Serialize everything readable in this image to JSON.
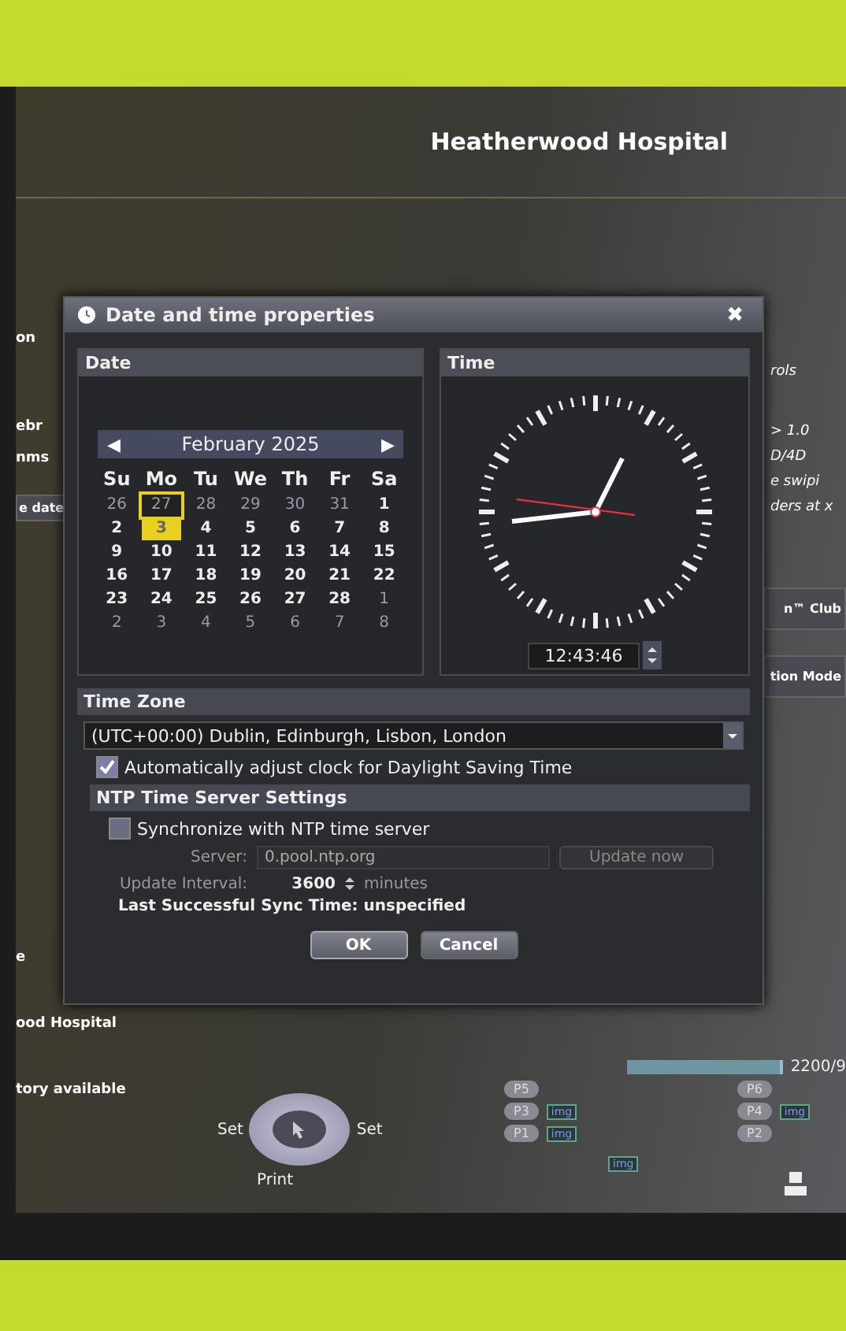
{
  "header": {
    "title": "Heatherwood Hospital"
  },
  "background_left": [
    {
      "text": "on",
      "kind": "label"
    },
    {
      "text": "ebr",
      "kind": "label"
    },
    {
      "text": "nms",
      "kind": "label"
    },
    {
      "text": "e date",
      "kind": "button"
    },
    {
      "text": "e",
      "kind": "label"
    },
    {
      "text": "ood Hospital",
      "kind": "label"
    },
    {
      "text": "tory available",
      "kind": "label"
    }
  ],
  "background_right": [
    {
      "text": "rols",
      "kind": "label"
    },
    {
      "text": "> 1.0",
      "kind": "label"
    },
    {
      "text": "D/4D",
      "kind": "label"
    },
    {
      "text": "e swipi",
      "kind": "label"
    },
    {
      "text": "ders at x",
      "kind": "label"
    },
    {
      "text": "n™ Club",
      "kind": "button"
    },
    {
      "text": "tion Mode",
      "kind": "button"
    }
  ],
  "dialog": {
    "title": "Date and time properties",
    "close": "✖",
    "date": {
      "heading": "Date",
      "prev": "◀",
      "next": "▶",
      "month": "February 2025",
      "weekdays": [
        "Su",
        "Mo",
        "Tu",
        "We",
        "Th",
        "Fr",
        "Sa"
      ],
      "days": [
        {
          "text": "26",
          "other_month": true,
          "selected": false,
          "hovered": false
        },
        {
          "text": "27",
          "other_month": true,
          "selected": false,
          "hovered": true
        },
        {
          "text": "28",
          "other_month": true,
          "selected": false,
          "hovered": false
        },
        {
          "text": "29",
          "other_month": true,
          "selected": false,
          "hovered": false
        },
        {
          "text": "30",
          "other_month": true,
          "selected": false,
          "hovered": false
        },
        {
          "text": "31",
          "other_month": true,
          "selected": false,
          "hovered": false
        },
        {
          "text": "1",
          "other_month": false,
          "selected": false,
          "hovered": false
        },
        {
          "text": "2",
          "other_month": false,
          "selected": false,
          "hovered": false
        },
        {
          "text": "3",
          "other_month": false,
          "selected": true,
          "hovered": false
        },
        {
          "text": "4",
          "other_month": false,
          "selected": false,
          "hovered": false
        },
        {
          "text": "5",
          "other_month": false,
          "selected": false,
          "hovered": false
        },
        {
          "text": "6",
          "other_month": false,
          "selected": false,
          "hovered": false
        },
        {
          "text": "7",
          "other_month": false,
          "selected": false,
          "hovered": false
        },
        {
          "text": "8",
          "other_month": false,
          "selected": false,
          "hovered": false
        },
        {
          "text": "9",
          "other_month": false,
          "selected": false,
          "hovered": false
        },
        {
          "text": "10",
          "other_month": false,
          "selected": false,
          "hovered": false
        },
        {
          "text": "11",
          "other_month": false,
          "selected": false,
          "hovered": false
        },
        {
          "text": "12",
          "other_month": false,
          "selected": false,
          "hovered": false
        },
        {
          "text": "13",
          "other_month": false,
          "selected": false,
          "hovered": false
        },
        {
          "text": "14",
          "other_month": false,
          "selected": false,
          "hovered": false
        },
        {
          "text": "15",
          "other_month": false,
          "selected": false,
          "hovered": false
        },
        {
          "text": "16",
          "other_month": false,
          "selected": false,
          "hovered": false
        },
        {
          "text": "17",
          "other_month": false,
          "selected": false,
          "hovered": false
        },
        {
          "text": "18",
          "other_month": false,
          "selected": false,
          "hovered": false
        },
        {
          "text": "19",
          "other_month": false,
          "selected": false,
          "hovered": false
        },
        {
          "text": "20",
          "other_month": false,
          "selected": false,
          "hovered": false
        },
        {
          "text": "21",
          "other_month": false,
          "selected": false,
          "hovered": false
        },
        {
          "text": "22",
          "other_month": false,
          "selected": false,
          "hovered": false
        },
        {
          "text": "23",
          "other_month": false,
          "selected": false,
          "hovered": false
        },
        {
          "text": "24",
          "other_month": false,
          "selected": false,
          "hovered": false
        },
        {
          "text": "25",
          "other_month": false,
          "selected": false,
          "hovered": false
        },
        {
          "text": "26",
          "other_month": false,
          "selected": false,
          "hovered": false
        },
        {
          "text": "27",
          "other_month": false,
          "selected": false,
          "hovered": false
        },
        {
          "text": "28",
          "other_month": false,
          "selected": false,
          "hovered": false
        },
        {
          "text": "1",
          "other_month": true,
          "selected": false,
          "hovered": false
        },
        {
          "text": "2",
          "other_month": true,
          "selected": false,
          "hovered": false
        },
        {
          "text": "3",
          "other_month": true,
          "selected": false,
          "hovered": false
        },
        {
          "text": "4",
          "other_month": true,
          "selected": false,
          "hovered": false
        },
        {
          "text": "5",
          "other_month": true,
          "selected": false,
          "hovered": false
        },
        {
          "text": "6",
          "other_month": true,
          "selected": false,
          "hovered": false
        },
        {
          "text": "7",
          "other_month": true,
          "selected": false,
          "hovered": false
        },
        {
          "text": "8",
          "other_month": true,
          "selected": false,
          "hovered": false
        }
      ]
    },
    "time": {
      "heading": "Time",
      "value": "12:43:46"
    },
    "time_zone": {
      "heading": "Time Zone",
      "value": "(UTC+00:00) Dublin, Edinburgh, Lisbon, London",
      "dst_label": "Automatically adjust clock for Daylight Saving Time",
      "dst_checked": true
    },
    "ntp": {
      "heading": "NTP Time Server Settings",
      "sync_label": "Synchronize with NTP time server",
      "sync_checked": false,
      "server_label": "Server:",
      "server": "0.pool.ntp.org",
      "update_button": "Update now",
      "interval_label": "Update Interval:",
      "interval": "3600",
      "interval_unit": "minutes",
      "last_sync": "Last Successful Sync Time: unspecified"
    },
    "buttons": [
      "OK",
      "Cancel"
    ]
  },
  "control_bar": {
    "progress": {
      "level": 0.97,
      "reading": "2200/9"
    },
    "trackball": {
      "left": "Set",
      "right": "Set",
      "bottom": "Print"
    },
    "presets_middle": [
      {
        "label": "P5"
      },
      {
        "label": "P3",
        "img": "img"
      },
      {
        "label": "P1",
        "img": "img"
      }
    ],
    "extra_img": "img",
    "presets_right": [
      {
        "label": "P6"
      },
      {
        "label": "P4",
        "img": "img"
      },
      {
        "label": "P2"
      }
    ]
  }
}
